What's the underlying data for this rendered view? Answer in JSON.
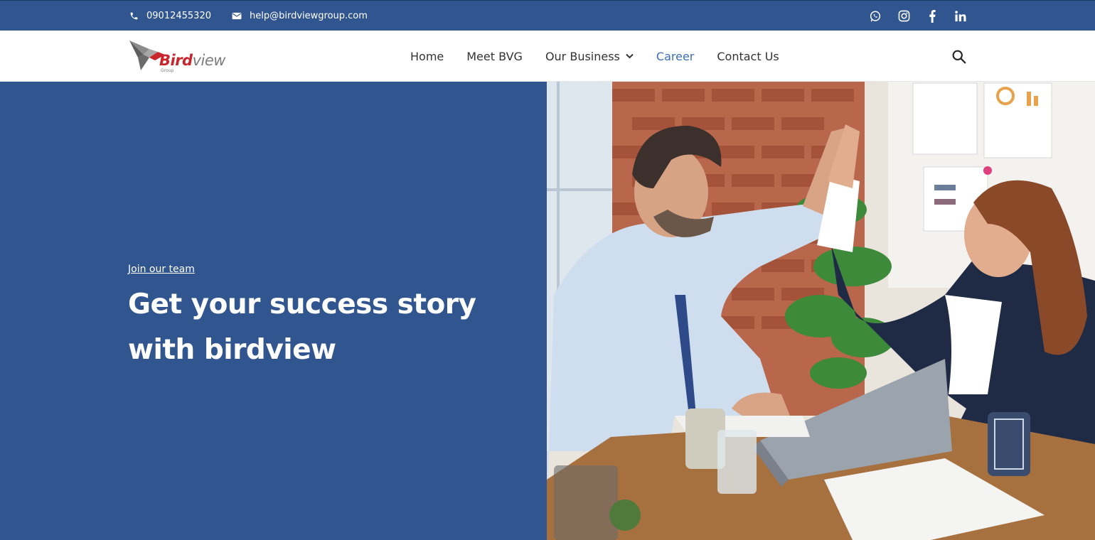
{
  "topbar": {
    "phone": "09012455320",
    "email": "help@birdviewgroup.com",
    "social_icons": [
      "whatsapp-icon",
      "instagram-icon",
      "facebook-icon",
      "linkedin-icon"
    ]
  },
  "header": {
    "logo": {
      "word_primary": "Bird",
      "word_secondary": "view",
      "sub": "Group"
    },
    "nav": [
      {
        "label": "Home"
      },
      {
        "label": "Meet BVG"
      },
      {
        "label": "Our Business",
        "has_dropdown": true
      },
      {
        "label": "Career",
        "active": true
      },
      {
        "label": "Contact Us"
      }
    ],
    "search_icon": "search-icon"
  },
  "hero": {
    "eyebrow": "Join our team",
    "headline": "Get your success story with birdview",
    "image": "office high-five photo"
  },
  "colors": {
    "brand_blue": "#30558f",
    "active_link": "#3d6fb6",
    "logo_red": "#c8262c",
    "logo_grey": "#7c7c7c"
  }
}
